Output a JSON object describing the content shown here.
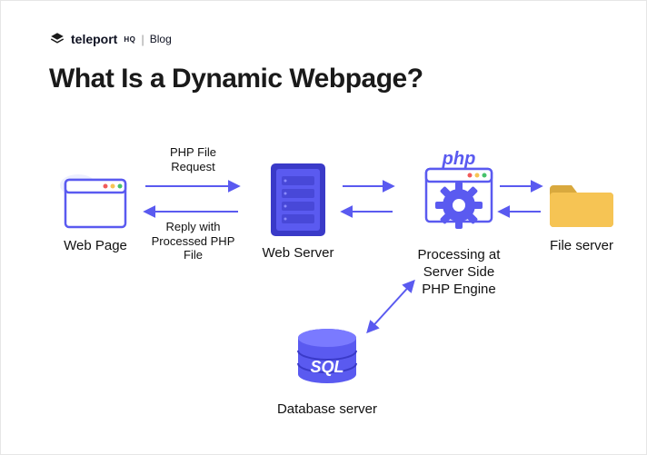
{
  "brand": {
    "logo_text": "teleport",
    "logo_sub": "HQ",
    "section": "Blog"
  },
  "title": "What Is a Dynamic Webpage?",
  "nodes": {
    "web_page": {
      "label": "Web Page"
    },
    "web_server": {
      "label": "Web Server"
    },
    "php_engine": {
      "label": "Processing at\nServer Side\nPHP Engine",
      "badge": "php"
    },
    "file_server": {
      "label": "File server"
    },
    "db_server": {
      "label": "Database server",
      "badge": "SQL"
    }
  },
  "edges": {
    "request": "PHP File\nRequest",
    "reply": "Reply with\nProcessed PHP\nFile"
  },
  "colors": {
    "indigo": "#5a5af0",
    "indigo_dark": "#3a3ac8",
    "folder": "#f6c454",
    "folder_dark": "#d9a93e"
  }
}
